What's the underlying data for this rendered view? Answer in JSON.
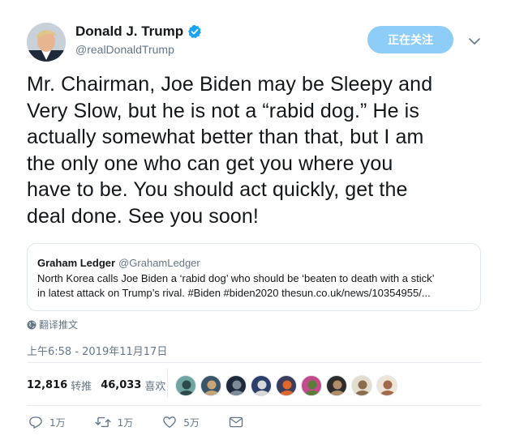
{
  "author": {
    "display_name": "Donald J. Trump",
    "handle": "@realDonaldTrump"
  },
  "follow_button": "正在关注",
  "tweet": {
    "lines": [
      "Mr. Chairman, Joe Biden may be Sleepy and",
      "Very Slow, but he is not a “rabid dog.” He is",
      "actually somewhat better than that, but I am",
      "the only one who can get you where you",
      "have to be. You should act quickly, get the",
      "deal done. See you soon!"
    ]
  },
  "quoted_tweet": {
    "display_name": "Graham Ledger",
    "handle": "@GrahamLedger",
    "line1": "North Korea calls Joe Biden a ‘rabid dog’ who should be ‘beaten to death with a stick’",
    "line2": "in latest attack on Trump’s rival. #Biden #biden2020  thesun.co.uk/news/10354955/..."
  },
  "translate_label": "翻译推文",
  "timestamp": "上午6:58 - 2019年11月17日",
  "stats": {
    "retweets_count": "12,816",
    "retweets_label": "转推",
    "likes_count": "46,033",
    "likes_label": "喜欢"
  },
  "likers": [
    {
      "bg": "#6fa6a0",
      "fg": "#2d4a4a"
    },
    {
      "bg": "#3b5568",
      "fg": "#c7a57a"
    },
    {
      "bg": "#1e2a3a",
      "fg": "#7f8b99"
    },
    {
      "bg": "#2b3f6a",
      "fg": "#d9d9d9"
    },
    {
      "bg": "#3a3d5c",
      "fg": "#e0662f"
    },
    {
      "bg": "#c24c8b",
      "fg": "#5a7d3a"
    },
    {
      "bg": "#2c2c2c",
      "fg": "#b08c6a"
    },
    {
      "bg": "#e4dccd",
      "fg": "#8a6d4d"
    },
    {
      "bg": "#efe4d6",
      "fg": "#a06a4c"
    }
  ],
  "actions": {
    "reply_count": "1万",
    "retweet_count": "1万",
    "like_count": "5万"
  },
  "colors": {
    "accent": "#1da1f2",
    "follow_bg": "#8ecdf8",
    "secondary_text": "#657786"
  }
}
